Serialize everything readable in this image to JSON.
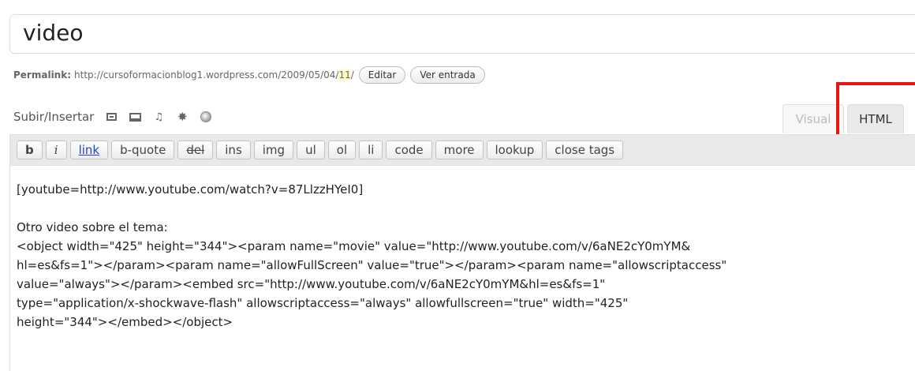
{
  "post": {
    "title": "video"
  },
  "permalink": {
    "label": "Permalink:",
    "url_prefix": "http://cursoformacionblog1.wordpress.com/2009/05/04/",
    "slug": "11",
    "url_suffix": "/",
    "edit_label": "Editar",
    "view_label": "Ver entrada"
  },
  "upload": {
    "label": "Subir/Insertar",
    "icons": [
      "add-image-icon",
      "add-video-icon",
      "add-audio-icon",
      "add-media-icon",
      "add-poll-icon"
    ]
  },
  "tabs": {
    "visual": "Visual",
    "html": "HTML"
  },
  "quicktags": [
    "b",
    "i",
    "link",
    "b-quote",
    "del",
    "ins",
    "img",
    "ul",
    "ol",
    "li",
    "code",
    "more",
    "lookup",
    "close tags"
  ],
  "content": {
    "lines": [
      "[youtube=http://www.youtube.com/watch?v=87LlzzHYeI0]",
      "",
      "Otro video sobre el tema:",
      "<object width=\"425\" height=\"344\"><param name=\"movie\" value=\"http://www.youtube.com/v/6aNE2cY0mYM&",
      "hl=es&fs=1\"></param><param name=\"allowFullScreen\" value=\"true\"></param><param name=\"allowscriptaccess\"",
      "value=\"always\"></param><embed src=\"http://www.youtube.com/v/6aNE2cY0mYM&hl=es&fs=1\"",
      "type=\"application/x-shockwave-flash\" allowscriptaccess=\"always\" allowfullscreen=\"true\" width=\"425\"",
      "height=\"344\"></embed></object>"
    ]
  },
  "colors": {
    "highlight": "#ee1111",
    "link": "#2244cc",
    "slug_background": "#fffbcc"
  }
}
